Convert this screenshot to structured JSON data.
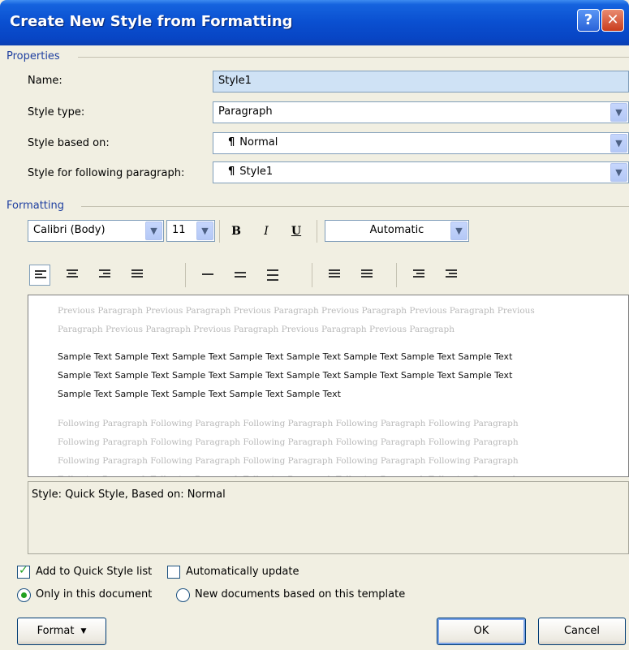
{
  "window": {
    "title": "Create New Style from Formatting",
    "help_icon": "question-icon",
    "close_icon": "close-icon"
  },
  "properties": {
    "section_label": "Properties",
    "name_label": "Name:",
    "name_value": "Style1",
    "style_type_label": "Style type:",
    "style_type_value": "Paragraph",
    "based_on_label": "Style based on:",
    "based_on_value": "Normal",
    "following_label": "Style for following paragraph:",
    "following_value": "Style1",
    "pilcrow": "¶"
  },
  "formatting": {
    "section_label": "Formatting",
    "font": "Calibri (Body)",
    "size": "11",
    "bold": "B",
    "italic": "I",
    "underline": "U",
    "color": "Automatic"
  },
  "preview": {
    "previous_lines": [
      "Previous Paragraph Previous Paragraph Previous Paragraph Previous Paragraph Previous Paragraph Previous",
      "Paragraph Previous Paragraph Previous Paragraph Previous Paragraph Previous Paragraph"
    ],
    "sample_lines": [
      "Sample Text Sample Text Sample Text Sample Text Sample Text Sample Text Sample Text Sample Text",
      "Sample Text Sample Text Sample Text Sample Text Sample Text Sample Text Sample Text Sample Text",
      "Sample Text Sample Text Sample Text Sample Text Sample Text"
    ],
    "following_lines": [
      "Following Paragraph Following Paragraph Following Paragraph Following Paragraph Following Paragraph",
      "Following Paragraph Following Paragraph Following Paragraph Following Paragraph Following Paragraph",
      "Following Paragraph Following Paragraph Following Paragraph Following Paragraph Following Paragraph",
      "Following Paragraph Following Paragraph Following Paragraph Following Paragraph Following Paragraph"
    ]
  },
  "description": "Style: Quick Style, Based on: Normal",
  "options": {
    "add_quick_style": "Add to Quick Style list",
    "add_quick_style_checked": true,
    "auto_update": "Automatically update",
    "auto_update_checked": false,
    "only_doc": "Only in this document",
    "only_doc_selected": true,
    "new_docs": "New documents based on this template",
    "new_docs_selected": false
  },
  "buttons": {
    "format": "Format",
    "ok": "OK",
    "cancel": "Cancel"
  },
  "colors": {
    "title_bar": "#0a4fd0",
    "section_label": "#1e3fa0",
    "selection": "#cfe2f5"
  }
}
